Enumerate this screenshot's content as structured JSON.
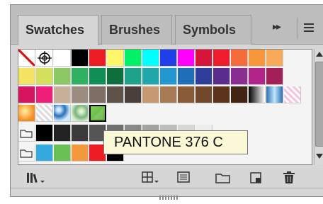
{
  "tabs": [
    {
      "label": "Swatches",
      "active": true
    },
    {
      "label": "Brushes",
      "active": false
    },
    {
      "label": "Symbols",
      "active": false
    }
  ],
  "panel_menu": {
    "flyout_arrows": "▸▸"
  },
  "swatch_rows": [
    [
      "none",
      "registration",
      "#ffffff",
      "#000000",
      "#ee1c24",
      "#fff568",
      "#00f067",
      "#00ffff",
      "#1f3fe8",
      "#ff00ff",
      "#d7153b",
      "#ee1c2c",
      "#f46b3c",
      "#f7963b",
      "#f8aa5b"
    ],
    [
      "#f5e463",
      "#d5df5e",
      "#8dc763",
      "#2fb062",
      "#0f8f55",
      "#0d6f3d",
      "#1ea38a",
      "#20a7aa",
      "#2296cf",
      "#1f6fb8",
      "#2f3e9a",
      "#5a2d8c",
      "#8a2d90",
      "#b3248a",
      "#a31f5a"
    ],
    [
      "#d5155e",
      "#ee1e7a",
      "#c6b09a",
      "#9c8c7f",
      "#7e6e63",
      "#5e5249",
      "#4a4039",
      "#c59a73",
      "#a77b53",
      "#8a5b37",
      "#72472a",
      "#5b331c",
      "#422414",
      "gradient-bw",
      "gradient-blue",
      "gradient-pink"
    ],
    [
      "gradient-orange",
      "pattern-checker",
      "pattern-blue",
      "pattern-green",
      "#6cbf4a"
    ],
    [
      "folder",
      "#000000",
      "#232323",
      "#3b3b3b",
      "#555555",
      "#6f6f6f",
      "#898989",
      "#a3a3a3",
      "#bdbdbd",
      "#d7d7d7",
      "#ededed"
    ],
    [
      "folder",
      "#36a9e1",
      "#69c055",
      "#f4993b",
      "#ee1c24",
      "#000000"
    ]
  ],
  "tooltip": {
    "text": "PANTONE 376 C"
  },
  "footer": {
    "icons": [
      "swatch-libraries-menu-icon",
      "show-swatch-kinds-icon",
      "swatch-options-icon",
      "new-color-group-icon",
      "new-swatch-icon",
      "delete-swatch-icon"
    ]
  }
}
